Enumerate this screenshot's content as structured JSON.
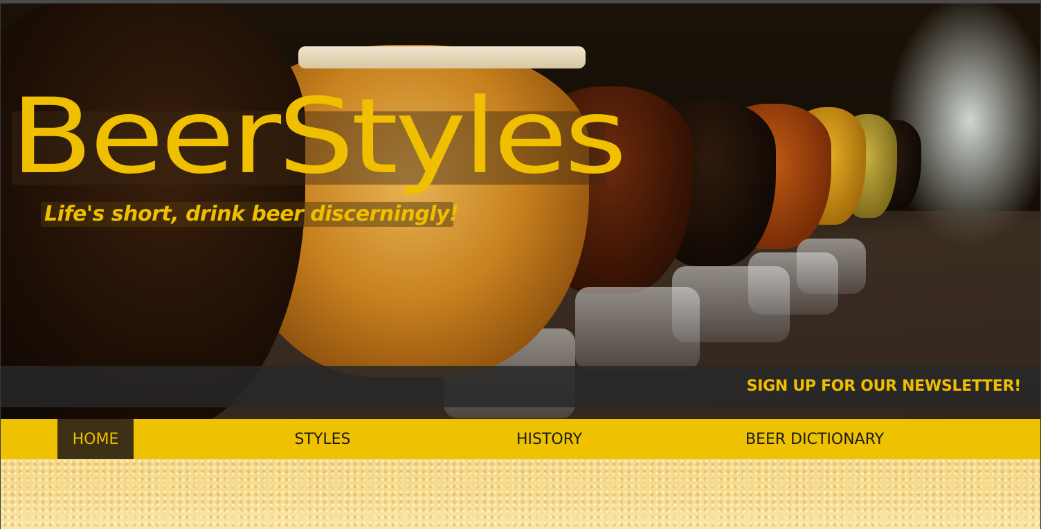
{
  "site": {
    "logo_text": "BeerStyles",
    "tagline": "Life's short, drink beer discerningly!"
  },
  "newsletter": {
    "label": "SIGN UP FOR OUR NEWSLETTER!"
  },
  "nav": {
    "items": [
      {
        "label": "HOME",
        "active": true
      },
      {
        "label": "STYLES",
        "active": false
      },
      {
        "label": "HISTORY",
        "active": false
      },
      {
        "label": "BEER DICTIONARY",
        "active": false
      }
    ]
  },
  "colors": {
    "brand_yellow": "#efc201",
    "active_nav_bg": "#3d3014",
    "newsletter_bar": "#282828"
  }
}
